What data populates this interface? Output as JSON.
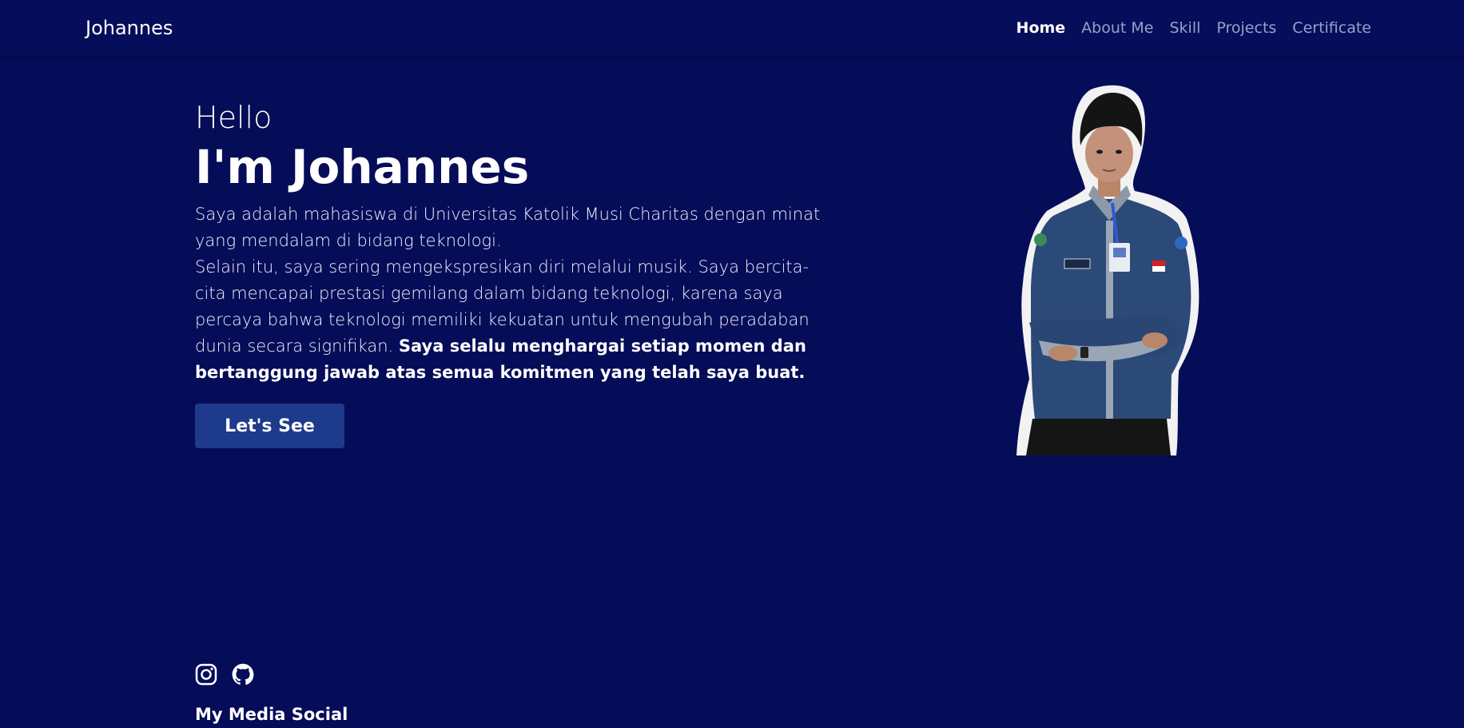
{
  "navbar": {
    "brand": "Johannes",
    "links": [
      {
        "label": "Home",
        "active": true
      },
      {
        "label": "About Me",
        "active": false
      },
      {
        "label": "Skill",
        "active": false
      },
      {
        "label": "Projects",
        "active": false
      },
      {
        "label": "Certificate",
        "active": false
      }
    ]
  },
  "hero": {
    "greeting": "Hello",
    "headline": "I'm Johannes",
    "bio_line_1": "Saya adalah mahasiswa di Universitas Katolik Musi Charitas dengan minat yang mendalam di bidang teknologi.",
    "bio_line_2": "Selain itu, saya sering mengekspresikan diri melalui musik. Saya bercita-cita mencapai prestasi gemilang dalam bidang teknologi, karena saya percaya bahwa teknologi memiliki kekuatan untuk mengubah peradaban dunia secara signifikan.",
    "bio_emphasis": "Saya selalu menghargai setiap momen dan bertanggung jawab atas semua komitmen yang telah saya buat.",
    "cta_label": "Let's See"
  },
  "social": {
    "icons": [
      "instagram-icon",
      "github-icon"
    ],
    "title": "My Media Social"
  },
  "colors": {
    "background": "#050c58",
    "navbar": "#060d5a",
    "button": "#1d3a8c",
    "nav_inactive": "#9aa0c8",
    "text": "#ffffff"
  }
}
